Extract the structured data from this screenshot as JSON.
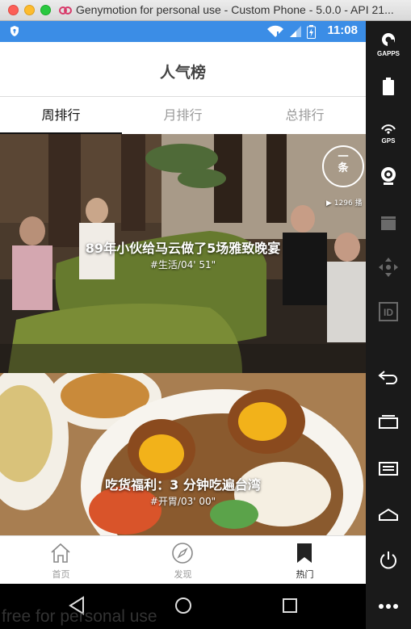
{
  "window": {
    "title": "Genymotion for personal use - Custom Phone - 5.0.0 - API 21..."
  },
  "status_bar": {
    "time": "11:08"
  },
  "app": {
    "title": "人气榜"
  },
  "tabs": [
    {
      "label": "周排行",
      "active": true
    },
    {
      "label": "月排行",
      "active": false
    },
    {
      "label": "总排行",
      "active": false
    }
  ],
  "badge": {
    "line1": "一",
    "line2": "条",
    "views": "▶ 1296 播"
  },
  "cards": [
    {
      "title": "89年小伙给马云做了5场雅致晚宴",
      "meta": "#生活/04' 51\""
    },
    {
      "title": "吃货福利：3 分钟吃遍台湾",
      "meta": "#开胃/03' 00\""
    }
  ],
  "bottom_nav": [
    {
      "label": "首页",
      "icon": "home-icon"
    },
    {
      "label": "发现",
      "icon": "compass-icon"
    },
    {
      "label": "热门",
      "icon": "bookmark-icon",
      "active": true
    }
  ],
  "sidebar": [
    {
      "label": "GAPPS",
      "icon": "gapps-icon"
    },
    {
      "label": "",
      "icon": "battery-icon"
    },
    {
      "label": "GPS",
      "icon": "gps-icon"
    },
    {
      "label": "",
      "icon": "webcam-icon"
    },
    {
      "label": "",
      "icon": "clapperboard-icon"
    },
    {
      "label": "",
      "icon": "dpad-icon"
    },
    {
      "label": "ID",
      "icon": "id-icon"
    },
    {
      "label": "",
      "icon": "back-icon"
    },
    {
      "label": "",
      "icon": "recent-apps-icon"
    },
    {
      "label": "",
      "icon": "menu-icon"
    },
    {
      "label": "",
      "icon": "home-icon"
    },
    {
      "label": "",
      "icon": "power-icon"
    },
    {
      "label": "",
      "icon": "more-icon"
    }
  ],
  "watermark": "free for personal use",
  "colors": {
    "status_bar": "#3b8de6",
    "sidebar": "#1a1a1a",
    "accent_text": "#111111"
  }
}
